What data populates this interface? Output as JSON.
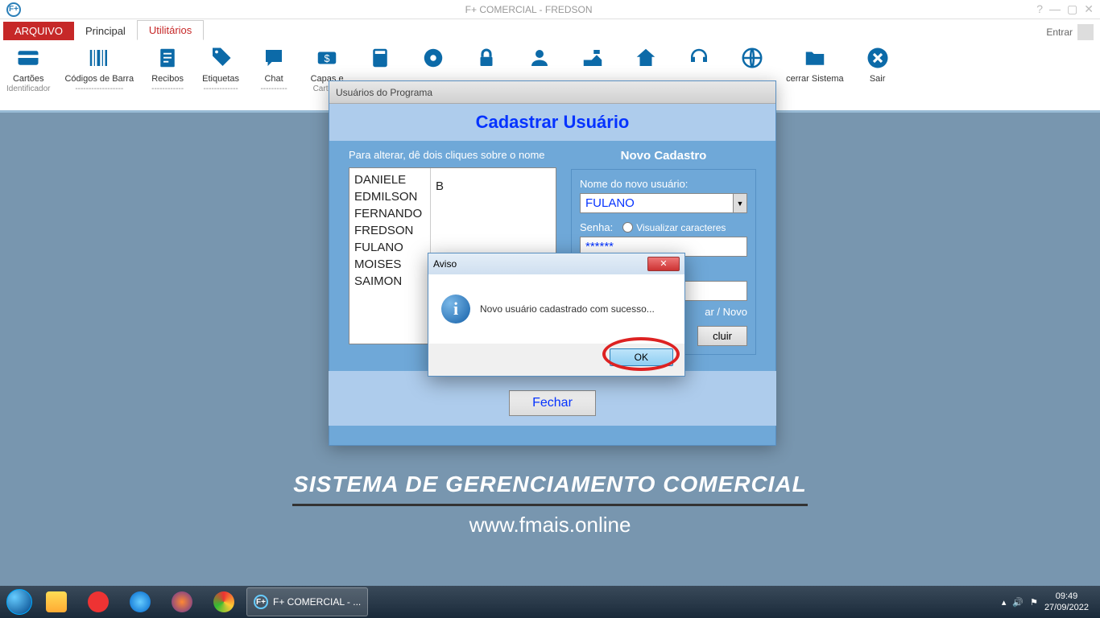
{
  "titlebar": {
    "title": "F+ COMERCIAL - FREDSON",
    "entrar": "Entrar"
  },
  "tabs": {
    "file": "ARQUIVO",
    "principal": "Principal",
    "utilitarios": "Utilitários"
  },
  "toolbar": {
    "items": [
      {
        "label": "Cartões",
        "sub": "Identificador"
      },
      {
        "label": "Códigos de Barra",
        "sub": "------------------"
      },
      {
        "label": "Recibos",
        "sub": "------------"
      },
      {
        "label": "Etiquetas",
        "sub": "-------------"
      },
      {
        "label": "Chat",
        "sub": "----------"
      },
      {
        "label": "Capas e",
        "sub": "Cartões"
      },
      {
        "label": "",
        "sub": ""
      },
      {
        "label": "",
        "sub": ""
      },
      {
        "label": "",
        "sub": ""
      },
      {
        "label": "",
        "sub": ""
      },
      {
        "label": "",
        "sub": ""
      },
      {
        "label": "",
        "sub": ""
      },
      {
        "label": "",
        "sub": ""
      },
      {
        "label": "",
        "sub": ""
      },
      {
        "label": "cerrar Sistema",
        "sub": ""
      },
      {
        "label": "Sair",
        "sub": ""
      }
    ]
  },
  "dialog": {
    "window_title": "Usuários do Programa",
    "header": "Cadastrar Usuário",
    "hint": "Para alterar, dê dois cliques sobre o nome",
    "users": [
      "DANIELE",
      "EDMILSON",
      "FERNANDO",
      "FREDSON",
      "FULANO",
      "MOISES",
      "SAIMON"
    ],
    "user_col2": [
      "",
      "",
      "B",
      "",
      "",
      "",
      ""
    ],
    "novo_cadastro": "Novo Cadastro",
    "nome_label": "Nome do novo usuário:",
    "nome_value": "FULANO",
    "senha_label": "Senha:",
    "visualizar": "Visualizar caracteres",
    "senha_value": "******",
    "limpar_novo": "ar  /  Novo",
    "excluir": "cluir",
    "fechar": "Fechar"
  },
  "aviso": {
    "title": "Aviso",
    "msg": "Novo usuário cadastrado com sucesso...",
    "ok": "OK"
  },
  "brand": {
    "title": "SISTEMA DE GERENCIAMENTO COMERCIAL",
    "url": "www.fmais.online"
  },
  "taskbar": {
    "app": "F+ COMERCIAL - ...",
    "time": "09:49",
    "date": "27/09/2022"
  }
}
